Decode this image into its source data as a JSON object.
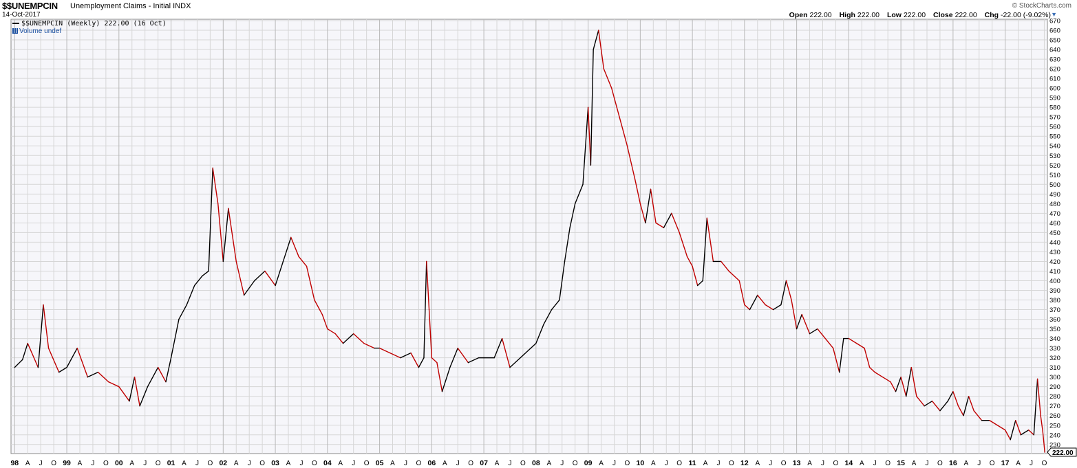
{
  "header": {
    "symbol": "$$UNEMPCIN",
    "description": "Unemployment Claims - Initial  INDX",
    "date": "14-Oct-2017",
    "brand": "© StockCharts.com",
    "ohlc": [
      {
        "label": "Open",
        "value": "222.00"
      },
      {
        "label": "High",
        "value": "222.00"
      },
      {
        "label": "Low",
        "value": "222.00"
      },
      {
        "label": "Close",
        "value": "222.00"
      },
      {
        "label": "Chg",
        "value": "-22.00 (-9.02%)"
      }
    ]
  },
  "legend": {
    "series_label": "$$UNEMPCIN (Weekly) 222.00 (16 Oct)",
    "volume_label": "Volume undef"
  },
  "colors": {
    "up": "#000000",
    "down": "#c00000",
    "grid": "#d6d6d6",
    "plot_bg": "#f6f6fa",
    "last_tag_bg": "#ffffff"
  },
  "chart_data": {
    "type": "line",
    "frequency": "weekly",
    "x_start": "1998-01",
    "x_end": "2017-10",
    "y_axis": {
      "min": 222,
      "max": 670,
      "step": 10,
      "side": "right"
    },
    "last_value_tag": "222.00",
    "x_ticks": [
      {
        "label": "98",
        "bold": true,
        "date": 1998.0
      },
      {
        "label": "A",
        "date": 1998.25
      },
      {
        "label": "J",
        "date": 1998.5
      },
      {
        "label": "O",
        "date": 1998.75
      },
      {
        "label": "99",
        "bold": true,
        "date": 1999.0
      },
      {
        "label": "A",
        "date": 1999.25
      },
      {
        "label": "J",
        "date": 1999.5
      },
      {
        "label": "O",
        "date": 1999.75
      },
      {
        "label": "00",
        "bold": true,
        "date": 2000.0
      },
      {
        "label": "A",
        "date": 2000.25
      },
      {
        "label": "J",
        "date": 2000.5
      },
      {
        "label": "O",
        "date": 2000.75
      },
      {
        "label": "01",
        "bold": true,
        "date": 2001.0
      },
      {
        "label": "A",
        "date": 2001.25
      },
      {
        "label": "J",
        "date": 2001.5
      },
      {
        "label": "O",
        "date": 2001.75
      },
      {
        "label": "02",
        "bold": true,
        "date": 2002.0
      },
      {
        "label": "A",
        "date": 2002.25
      },
      {
        "label": "J",
        "date": 2002.5
      },
      {
        "label": "O",
        "date": 2002.75
      },
      {
        "label": "03",
        "bold": true,
        "date": 2003.0
      },
      {
        "label": "A",
        "date": 2003.25
      },
      {
        "label": "J",
        "date": 2003.5
      },
      {
        "label": "O",
        "date": 2003.75
      },
      {
        "label": "04",
        "bold": true,
        "date": 2004.0
      },
      {
        "label": "A",
        "date": 2004.25
      },
      {
        "label": "J",
        "date": 2004.5
      },
      {
        "label": "O",
        "date": 2004.75
      },
      {
        "label": "05",
        "bold": true,
        "date": 2005.0
      },
      {
        "label": "A",
        "date": 2005.25
      },
      {
        "label": "J",
        "date": 2005.5
      },
      {
        "label": "O",
        "date": 2005.75
      },
      {
        "label": "06",
        "bold": true,
        "date": 2006.0
      },
      {
        "label": "A",
        "date": 2006.25
      },
      {
        "label": "J",
        "date": 2006.5
      },
      {
        "label": "O",
        "date": 2006.75
      },
      {
        "label": "07",
        "bold": true,
        "date": 2007.0
      },
      {
        "label": "A",
        "date": 2007.25
      },
      {
        "label": "J",
        "date": 2007.5
      },
      {
        "label": "O",
        "date": 2007.75
      },
      {
        "label": "08",
        "bold": true,
        "date": 2008.0
      },
      {
        "label": "A",
        "date": 2008.25
      },
      {
        "label": "J",
        "date": 2008.5
      },
      {
        "label": "O",
        "date": 2008.75
      },
      {
        "label": "09",
        "bold": true,
        "date": 2009.0
      },
      {
        "label": "A",
        "date": 2009.25
      },
      {
        "label": "J",
        "date": 2009.5
      },
      {
        "label": "O",
        "date": 2009.75
      },
      {
        "label": "10",
        "bold": true,
        "date": 2010.0
      },
      {
        "label": "A",
        "date": 2010.25
      },
      {
        "label": "J",
        "date": 2010.5
      },
      {
        "label": "O",
        "date": 2010.75
      },
      {
        "label": "11",
        "bold": true,
        "date": 2011.0
      },
      {
        "label": "A",
        "date": 2011.25
      },
      {
        "label": "J",
        "date": 2011.5
      },
      {
        "label": "O",
        "date": 2011.75
      },
      {
        "label": "12",
        "bold": true,
        "date": 2012.0
      },
      {
        "label": "A",
        "date": 2012.25
      },
      {
        "label": "J",
        "date": 2012.5
      },
      {
        "label": "O",
        "date": 2012.75
      },
      {
        "label": "13",
        "bold": true,
        "date": 2013.0
      },
      {
        "label": "A",
        "date": 2013.25
      },
      {
        "label": "J",
        "date": 2013.5
      },
      {
        "label": "O",
        "date": 2013.75
      },
      {
        "label": "14",
        "bold": true,
        "date": 2014.0
      },
      {
        "label": "A",
        "date": 2014.25
      },
      {
        "label": "J",
        "date": 2014.5
      },
      {
        "label": "O",
        "date": 2014.75
      },
      {
        "label": "15",
        "bold": true,
        "date": 2015.0
      },
      {
        "label": "A",
        "date": 2015.25
      },
      {
        "label": "J",
        "date": 2015.5
      },
      {
        "label": "O",
        "date": 2015.75
      },
      {
        "label": "16",
        "bold": true,
        "date": 2016.0
      },
      {
        "label": "A",
        "date": 2016.25
      },
      {
        "label": "J",
        "date": 2016.5
      },
      {
        "label": "O",
        "date": 2016.75
      },
      {
        "label": "17",
        "bold": true,
        "date": 2017.0
      },
      {
        "label": "A",
        "date": 2017.25
      },
      {
        "label": "J",
        "date": 2017.5
      },
      {
        "label": "O",
        "date": 2017.75
      }
    ],
    "series": [
      {
        "points": [
          [
            1998.0,
            310
          ],
          [
            1998.15,
            318
          ],
          [
            1998.25,
            335
          ],
          [
            1998.45,
            310
          ],
          [
            1998.55,
            375
          ],
          [
            1998.65,
            330
          ],
          [
            1998.85,
            305
          ],
          [
            1999.0,
            310
          ],
          [
            1999.2,
            330
          ],
          [
            1999.4,
            300
          ],
          [
            1999.6,
            305
          ],
          [
            1999.8,
            295
          ],
          [
            2000.0,
            290
          ],
          [
            2000.2,
            275
          ],
          [
            2000.3,
            300
          ],
          [
            2000.4,
            270
          ],
          [
            2000.55,
            290
          ],
          [
            2000.75,
            310
          ],
          [
            2000.9,
            295
          ],
          [
            2001.0,
            320
          ],
          [
            2001.15,
            360
          ],
          [
            2001.3,
            375
          ],
          [
            2001.45,
            395
          ],
          [
            2001.6,
            405
          ],
          [
            2001.72,
            410
          ],
          [
            2001.8,
            517
          ],
          [
            2001.9,
            480
          ],
          [
            2002.0,
            420
          ],
          [
            2002.1,
            475
          ],
          [
            2002.25,
            420
          ],
          [
            2002.4,
            385
          ],
          [
            2002.6,
            400
          ],
          [
            2002.8,
            410
          ],
          [
            2003.0,
            395
          ],
          [
            2003.15,
            420
          ],
          [
            2003.3,
            445
          ],
          [
            2003.45,
            425
          ],
          [
            2003.6,
            415
          ],
          [
            2003.75,
            380
          ],
          [
            2003.9,
            365
          ],
          [
            2004.0,
            350
          ],
          [
            2004.15,
            345
          ],
          [
            2004.3,
            335
          ],
          [
            2004.5,
            345
          ],
          [
            2004.7,
            335
          ],
          [
            2004.9,
            330
          ],
          [
            2005.0,
            330
          ],
          [
            2005.2,
            325
          ],
          [
            2005.4,
            320
          ],
          [
            2005.6,
            325
          ],
          [
            2005.75,
            310
          ],
          [
            2005.85,
            320
          ],
          [
            2005.9,
            420
          ],
          [
            2005.95,
            370
          ],
          [
            2006.0,
            320
          ],
          [
            2006.1,
            315
          ],
          [
            2006.2,
            285
          ],
          [
            2006.35,
            310
          ],
          [
            2006.5,
            330
          ],
          [
            2006.7,
            315
          ],
          [
            2006.9,
            320
          ],
          [
            2007.0,
            320
          ],
          [
            2007.2,
            320
          ],
          [
            2007.35,
            340
          ],
          [
            2007.5,
            310
          ],
          [
            2007.7,
            320
          ],
          [
            2007.9,
            330
          ],
          [
            2008.0,
            335
          ],
          [
            2008.15,
            355
          ],
          [
            2008.3,
            370
          ],
          [
            2008.45,
            380
          ],
          [
            2008.55,
            420
          ],
          [
            2008.65,
            455
          ],
          [
            2008.75,
            480
          ],
          [
            2008.9,
            500
          ],
          [
            2009.0,
            580
          ],
          [
            2009.05,
            520
          ],
          [
            2009.1,
            640
          ],
          [
            2009.2,
            660
          ],
          [
            2009.3,
            620
          ],
          [
            2009.45,
            600
          ],
          [
            2009.6,
            570
          ],
          [
            2009.75,
            540
          ],
          [
            2009.9,
            505
          ],
          [
            2010.0,
            480
          ],
          [
            2010.1,
            460
          ],
          [
            2010.2,
            495
          ],
          [
            2010.3,
            460
          ],
          [
            2010.45,
            455
          ],
          [
            2010.6,
            470
          ],
          [
            2010.75,
            450
          ],
          [
            2010.9,
            425
          ],
          [
            2011.0,
            415
          ],
          [
            2011.1,
            395
          ],
          [
            2011.2,
            400
          ],
          [
            2011.28,
            465
          ],
          [
            2011.4,
            420
          ],
          [
            2011.55,
            420
          ],
          [
            2011.7,
            410
          ],
          [
            2011.9,
            400
          ],
          [
            2012.0,
            375
          ],
          [
            2012.1,
            370
          ],
          [
            2012.25,
            385
          ],
          [
            2012.4,
            375
          ],
          [
            2012.55,
            370
          ],
          [
            2012.7,
            375
          ],
          [
            2012.8,
            400
          ],
          [
            2012.9,
            380
          ],
          [
            2013.0,
            350
          ],
          [
            2013.1,
            365
          ],
          [
            2013.25,
            345
          ],
          [
            2013.4,
            350
          ],
          [
            2013.55,
            340
          ],
          [
            2013.7,
            330
          ],
          [
            2013.82,
            305
          ],
          [
            2013.9,
            340
          ],
          [
            2014.0,
            340
          ],
          [
            2014.15,
            335
          ],
          [
            2014.3,
            330
          ],
          [
            2014.4,
            310
          ],
          [
            2014.5,
            305
          ],
          [
            2014.65,
            300
          ],
          [
            2014.8,
            295
          ],
          [
            2014.9,
            285
          ],
          [
            2015.0,
            300
          ],
          [
            2015.1,
            280
          ],
          [
            2015.2,
            310
          ],
          [
            2015.3,
            280
          ],
          [
            2015.45,
            270
          ],
          [
            2015.6,
            275
          ],
          [
            2015.75,
            265
          ],
          [
            2015.9,
            275
          ],
          [
            2016.0,
            285
          ],
          [
            2016.1,
            270
          ],
          [
            2016.2,
            260
          ],
          [
            2016.3,
            280
          ],
          [
            2016.4,
            265
          ],
          [
            2016.55,
            255
          ],
          [
            2016.7,
            255
          ],
          [
            2016.85,
            250
          ],
          [
            2017.0,
            245
          ],
          [
            2017.1,
            235
          ],
          [
            2017.2,
            255
          ],
          [
            2017.3,
            240
          ],
          [
            2017.45,
            245
          ],
          [
            2017.55,
            240
          ],
          [
            2017.62,
            298
          ],
          [
            2017.68,
            260
          ],
          [
            2017.72,
            244
          ],
          [
            2017.76,
            222
          ]
        ]
      }
    ]
  }
}
